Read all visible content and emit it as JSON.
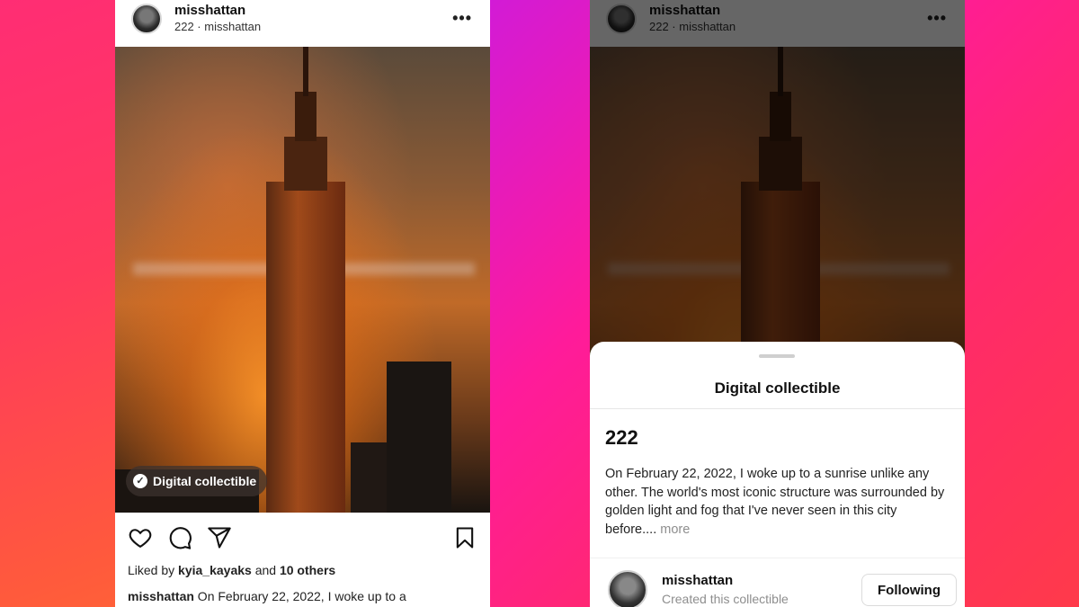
{
  "post": {
    "username": "misshattan",
    "subline": "222 · misshattan",
    "badge_label": "Digital collectible",
    "liked_by_prefix": "Liked by ",
    "liked_by_user": "kyia_kayaks",
    "liked_by_and": " and ",
    "liked_by_others": "10 others",
    "caption_user": "misshattan",
    "caption_text": " On February 22, 2022, I woke up to a"
  },
  "sheet": {
    "title": "Digital collectible",
    "nft_name": "222",
    "description": "On February 22, 2022, I woke up to a sunrise unlike any other. The world's most iconic structure was surrounded by golden light and fog that I've never seen in this city before....",
    "more_label": " more",
    "creator_name": "misshattan",
    "creator_role": "Created this collectible",
    "following_label": "Following"
  },
  "icons": {
    "more": "more-horizontal-icon",
    "heart": "heart-icon",
    "comment": "comment-icon",
    "share": "share-icon",
    "bookmark": "bookmark-icon",
    "check": "check-circle-icon"
  },
  "colors": {
    "brand_gradient_start": "#ff2d74",
    "brand_gradient_end": "#ff8a1e",
    "accent_purple": "#d21bd6",
    "secondary_text": "#8e8e8e"
  }
}
